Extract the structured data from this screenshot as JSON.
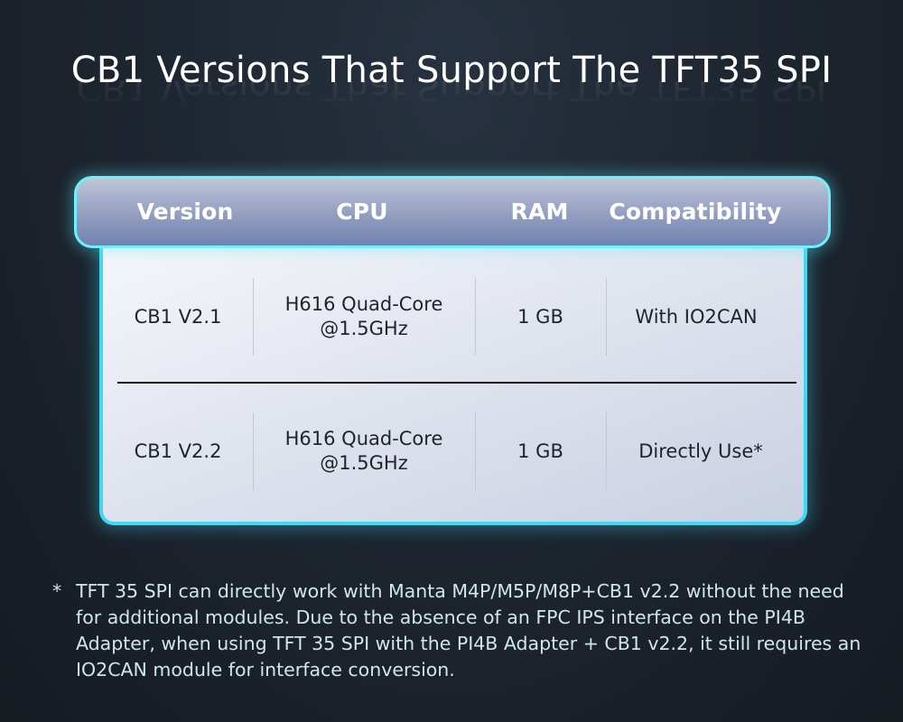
{
  "title": "CB1 Versions That Support The TFT35 SPI",
  "table": {
    "headers": [
      "Version",
      "CPU",
      "RAM",
      "Compatibility"
    ],
    "rows": [
      {
        "version": "CB1 V2.1",
        "cpu_line1": "H616 Quad-Core",
        "cpu_line2": "@1.5GHz",
        "ram": "1 GB",
        "compatibility": "With IO2CAN"
      },
      {
        "version": "CB1 V2.2",
        "cpu_line1": "H616 Quad-Core",
        "cpu_line2": "@1.5GHz",
        "ram": "1 GB",
        "compatibility": "Directly Use*"
      }
    ]
  },
  "footnote": {
    "marker": "*",
    "text": "TFT 35 SPI can directly work with Manta M4P/M5P/M8P+CB1 v2.2 without the need for additional modules. Due to the absence of an FPC IPS interface on the PI4B Adapter, when using TFT 35 SPI with the PI4B Adapter + CB1 v2.2, it still requires an IO2CAN module for interface conversion."
  },
  "colors": {
    "background": "#1e2631",
    "accent_glow": "#3fd9f5",
    "header_fill": "#8f9bc0",
    "text_dark": "#1f232a",
    "note_text": "#cfe6ea"
  }
}
